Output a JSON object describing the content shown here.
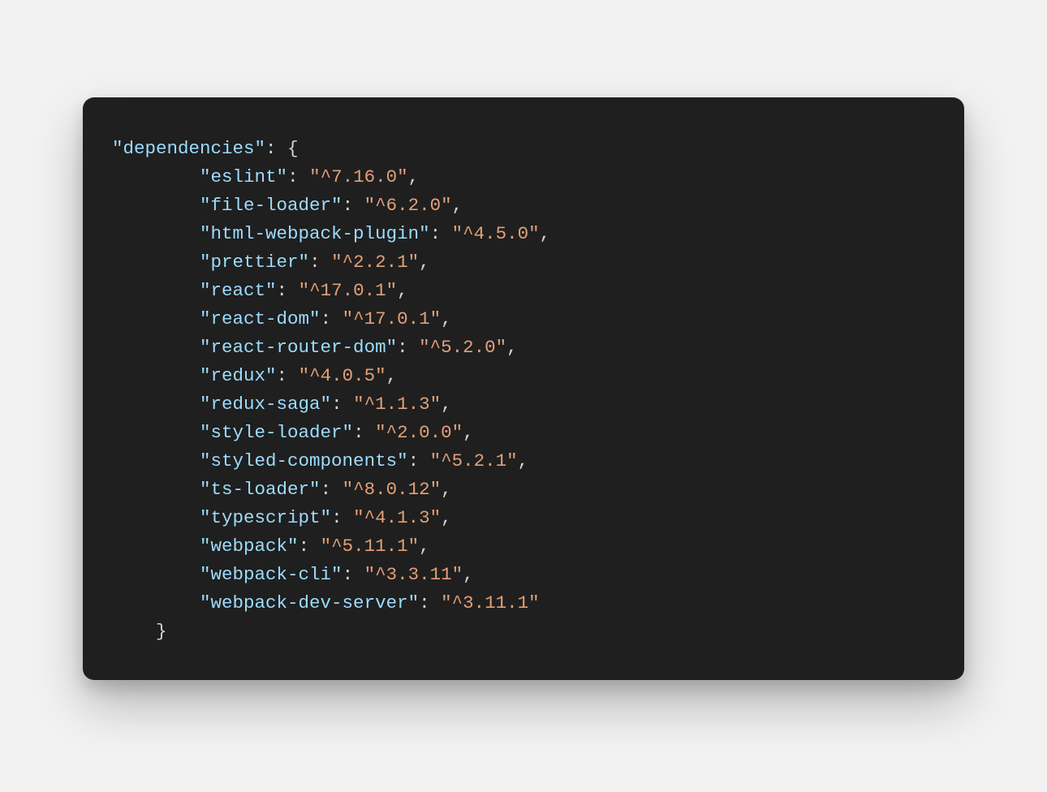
{
  "code": {
    "section_key": "\"dependencies\"",
    "open_brace": "{",
    "close_brace": "}",
    "colon": ":",
    "comma": ",",
    "space": " ",
    "indent1": "    ",
    "indent2": "        ",
    "entries": [
      {
        "key": "\"eslint\"",
        "value": "\"^7.16.0\""
      },
      {
        "key": "\"file-loader\"",
        "value": "\"^6.2.0\""
      },
      {
        "key": "\"html-webpack-plugin\"",
        "value": "\"^4.5.0\""
      },
      {
        "key": "\"prettier\"",
        "value": "\"^2.2.1\""
      },
      {
        "key": "\"react\"",
        "value": "\"^17.0.1\""
      },
      {
        "key": "\"react-dom\"",
        "value": "\"^17.0.1\""
      },
      {
        "key": "\"react-router-dom\"",
        "value": "\"^5.2.0\""
      },
      {
        "key": "\"redux\"",
        "value": "\"^4.0.5\""
      },
      {
        "key": "\"redux-saga\"",
        "value": "\"^1.1.3\""
      },
      {
        "key": "\"style-loader\"",
        "value": "\"^2.0.0\""
      },
      {
        "key": "\"styled-components\"",
        "value": "\"^5.2.1\""
      },
      {
        "key": "\"ts-loader\"",
        "value": "\"^8.0.12\""
      },
      {
        "key": "\"typescript\"",
        "value": "\"^4.1.3\""
      },
      {
        "key": "\"webpack\"",
        "value": "\"^5.11.1\""
      },
      {
        "key": "\"webpack-cli\"",
        "value": "\"^3.3.11\""
      },
      {
        "key": "\"webpack-dev-server\"",
        "value": "\"^3.11.1\""
      }
    ]
  }
}
